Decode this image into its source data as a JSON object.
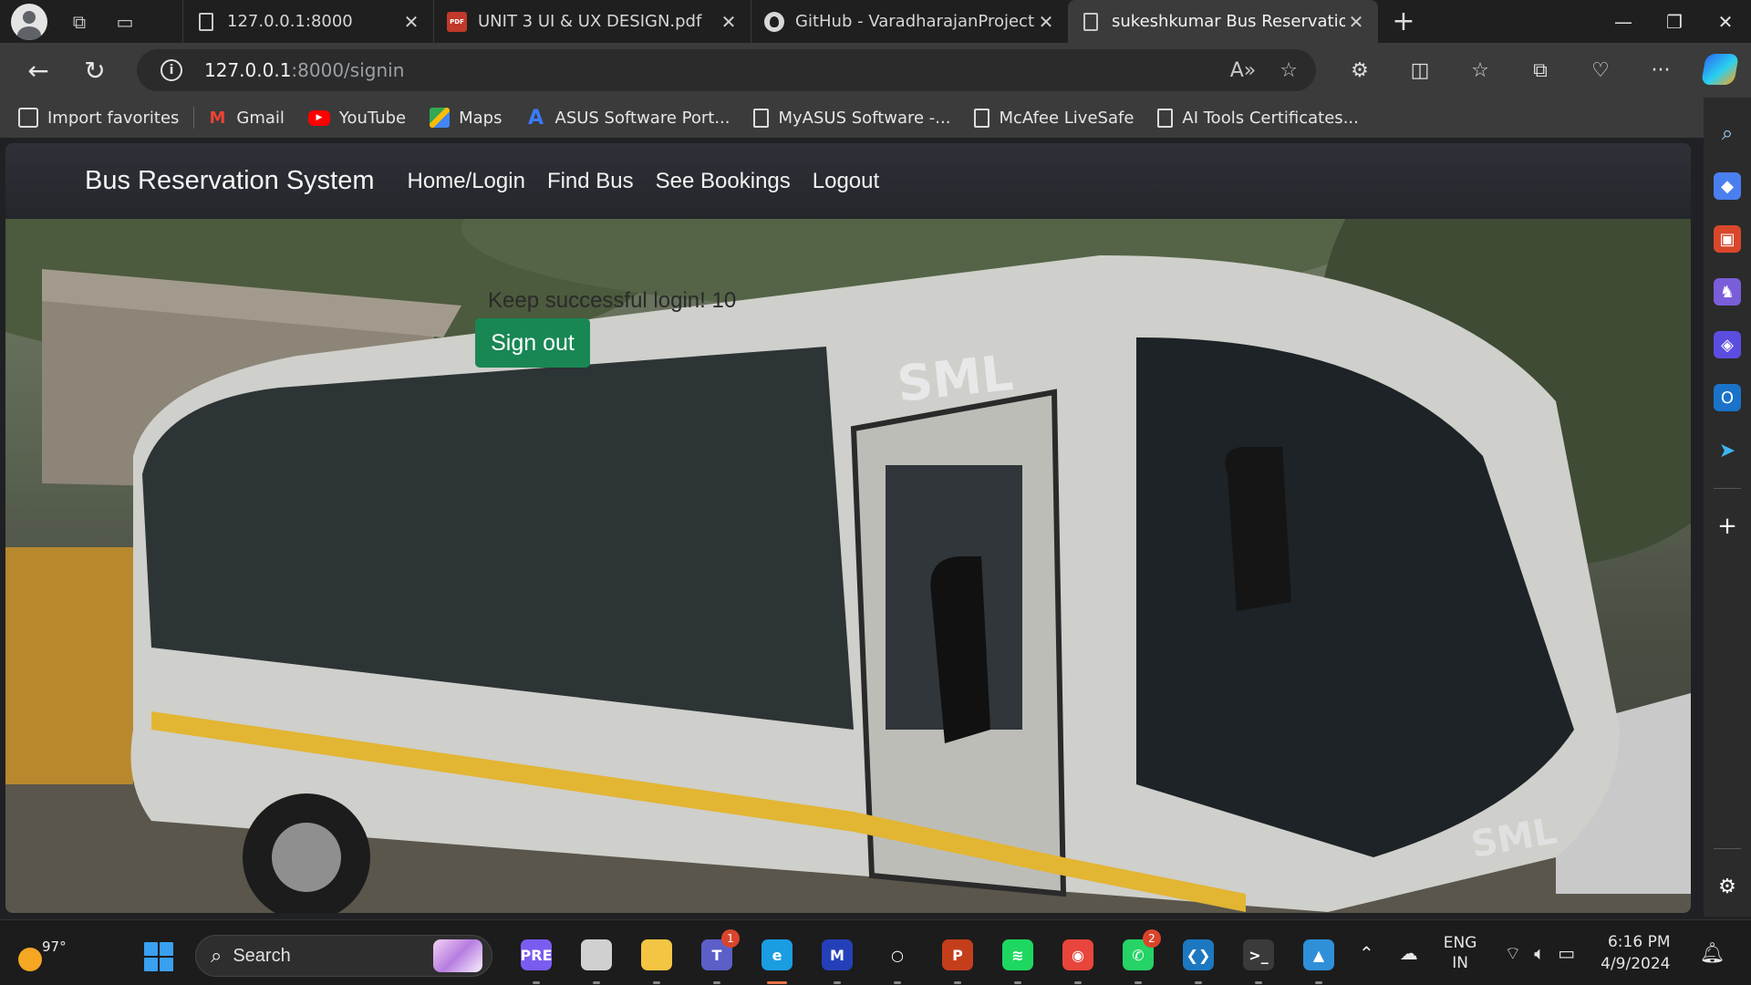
{
  "browser": {
    "tabs": [
      {
        "title": "127.0.0.1:8000",
        "favicon": "page-icon",
        "active": false
      },
      {
        "title": "UNIT 3 UI & UX DESIGN.pdf",
        "favicon": "pdf-icon",
        "active": false
      },
      {
        "title": "GitHub - VaradharajanProjects/",
        "favicon": "github-icon",
        "active": false
      },
      {
        "title": "sukeshkumar Bus Reservation Sy",
        "favicon": "page-icon",
        "active": true
      }
    ],
    "url_host": "127.0.0.1",
    "url_path": ":8000/signin",
    "favorites": [
      {
        "label": "Import favorites",
        "icon": "import-icon"
      },
      {
        "label": "Gmail",
        "icon": "gmail-icon"
      },
      {
        "label": "YouTube",
        "icon": "youtube-icon"
      },
      {
        "label": "Maps",
        "icon": "maps-icon"
      },
      {
        "label": "ASUS Software Port...",
        "icon": "asus-icon"
      },
      {
        "label": "MyASUS Software -...",
        "icon": "page-icon"
      },
      {
        "label": "McAfee LiveSafe",
        "icon": "page-icon"
      },
      {
        "label": "AI Tools Certificates...",
        "icon": "page-icon"
      }
    ]
  },
  "site": {
    "brand": "Bus Reservation System",
    "nav": [
      "Home/Login",
      "Find Bus",
      "See Bookings",
      "Logout"
    ],
    "message": "Keep successful login! 10",
    "signout_label": "Sign out",
    "signout_color": "#198754"
  },
  "taskbar": {
    "weather_temp": "97°",
    "search_label": "Search",
    "apps": [
      {
        "name": "copilot-pre",
        "color": "#7b5cf0",
        "glyph": "PRE"
      },
      {
        "name": "task-view",
        "color": "#d0d0d0",
        "glyph": ""
      },
      {
        "name": "file-explorer",
        "color": "#f4c542",
        "glyph": ""
      },
      {
        "name": "teams",
        "color": "#5b5fc7",
        "glyph": "T",
        "badge": "1"
      },
      {
        "name": "edge",
        "color": "#1b9de2",
        "glyph": "e",
        "active": true
      },
      {
        "name": "vs-ml",
        "color": "#2440b8",
        "glyph": "M"
      },
      {
        "name": "cortana",
        "color": "#1c1c1c",
        "glyph": "○"
      },
      {
        "name": "powerpoint",
        "color": "#c43e1c",
        "glyph": "P"
      },
      {
        "name": "spotify",
        "color": "#1ed760",
        "glyph": "≋"
      },
      {
        "name": "chrome",
        "color": "#e8453c",
        "glyph": "◉"
      },
      {
        "name": "whatsapp",
        "color": "#25d366",
        "glyph": "✆",
        "badge": "2"
      },
      {
        "name": "vscode",
        "color": "#1c78c0",
        "glyph": "❮❯"
      },
      {
        "name": "terminal",
        "color": "#3a3a3a",
        "glyph": ">_"
      },
      {
        "name": "photos",
        "color": "#2f8fd8",
        "glyph": "▲"
      }
    ],
    "lang_top": "ENG",
    "lang_bottom": "IN",
    "time": "6:16 PM",
    "date": "4/9/2024"
  }
}
